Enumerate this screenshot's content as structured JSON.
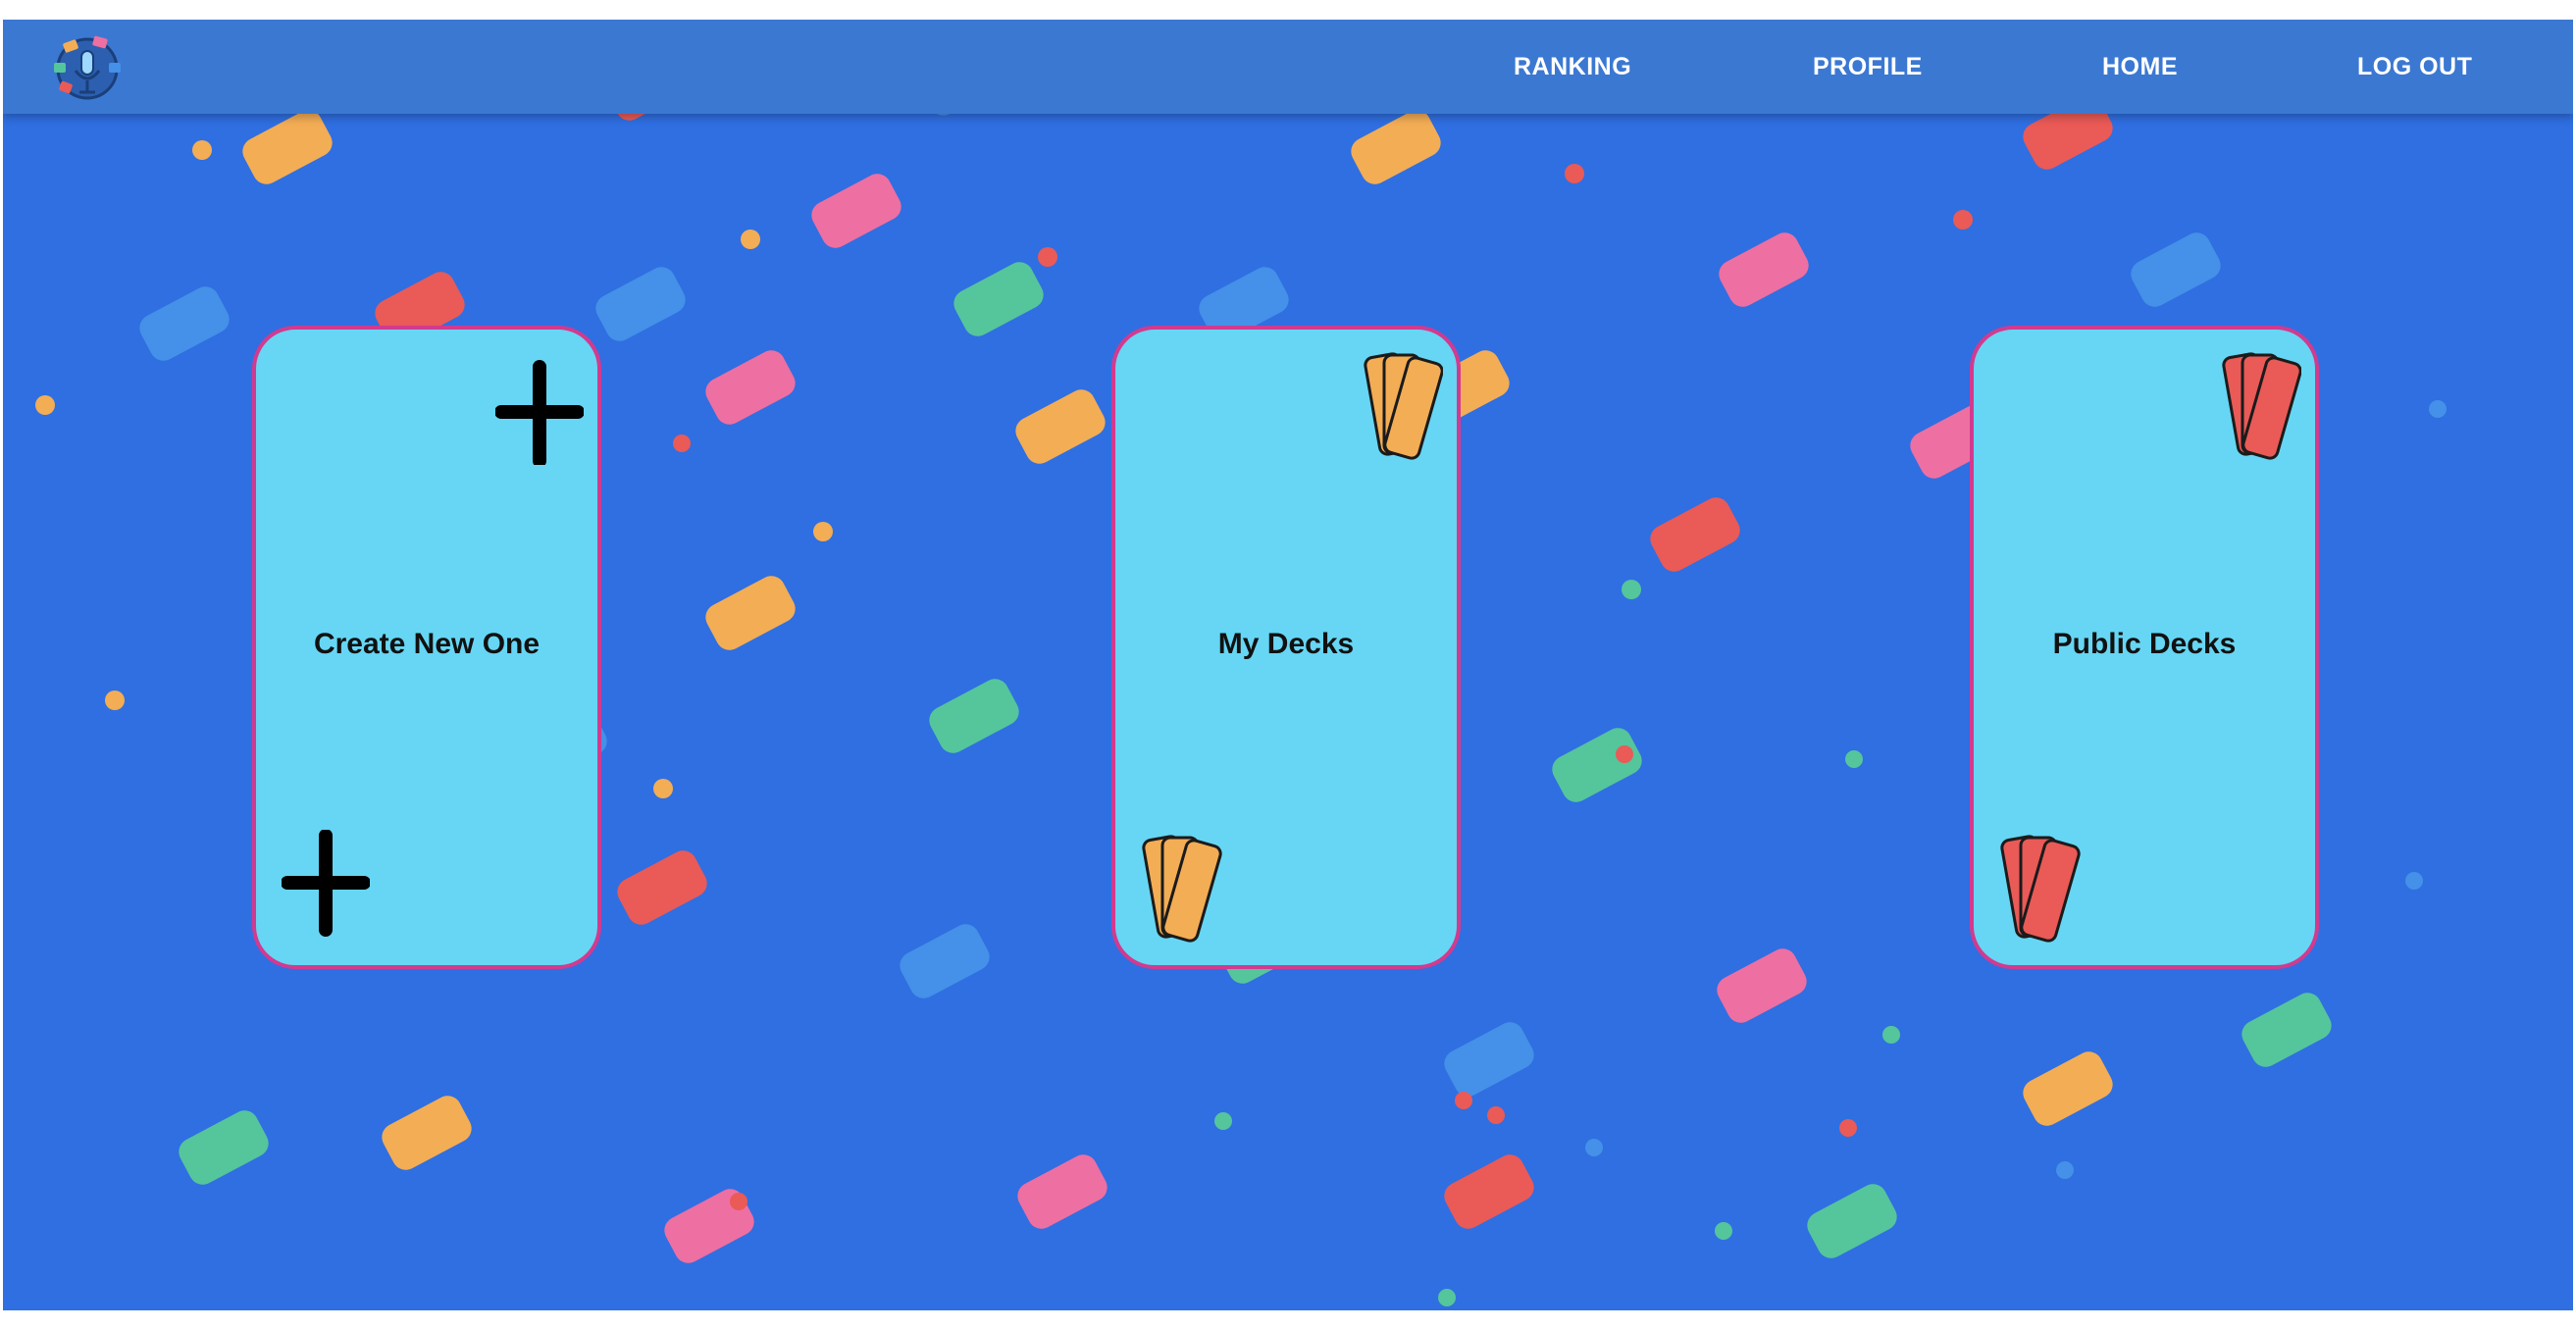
{
  "nav": {
    "items": [
      {
        "label": "RANKING"
      },
      {
        "label": "PROFILE"
      },
      {
        "label": "HOME"
      },
      {
        "label": "LOG OUT"
      }
    ]
  },
  "cards": [
    {
      "title": "Create New One",
      "icon": "plus-icon"
    },
    {
      "title": "My Decks",
      "icon": "cards-icon",
      "color": "#f3ad55"
    },
    {
      "title": "Public Decks",
      "icon": "cards-icon",
      "color": "#ea5a57"
    }
  ],
  "colors": {
    "background": "#2f6fe1",
    "navbar": "#3b78d2",
    "card_fill": "#66d6f4",
    "card_border": "#d23a8f",
    "confetti": [
      "#f3ad55",
      "#ea5a57",
      "#ee6fa2",
      "#55c59c",
      "#4590e8"
    ]
  }
}
